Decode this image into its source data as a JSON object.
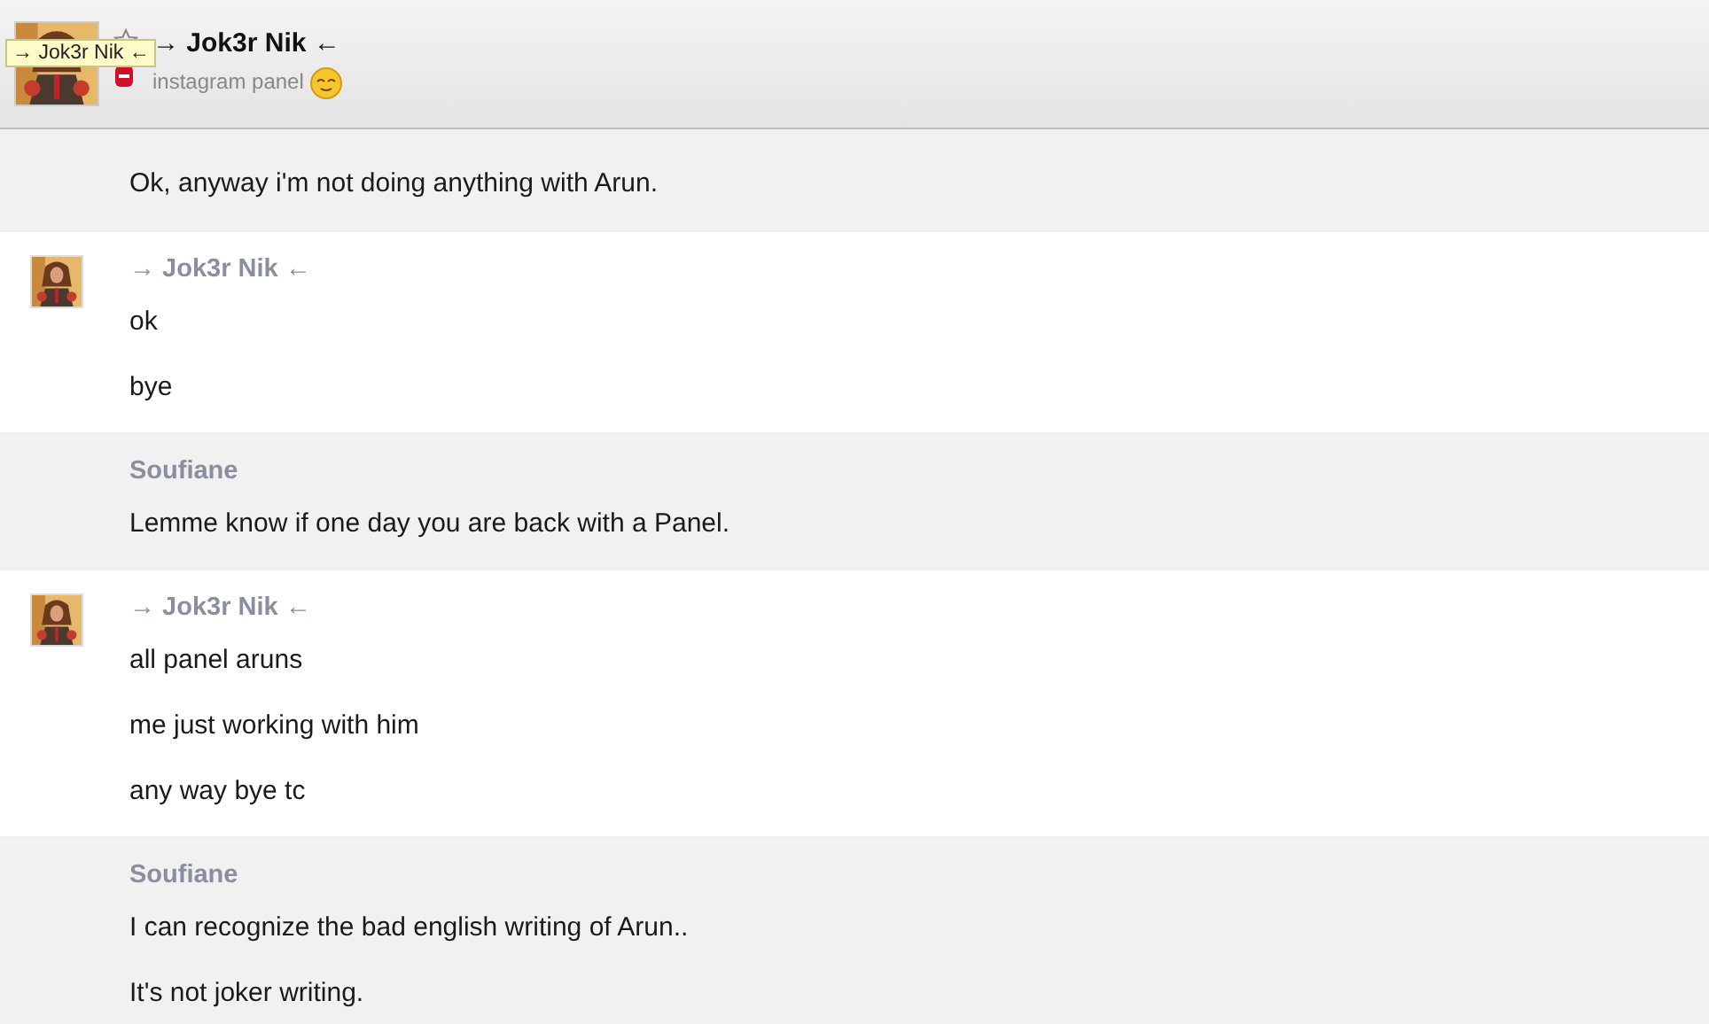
{
  "header": {
    "title": "→ Jok3r Nik ←",
    "subtitle": "instagram panel",
    "tooltip": "→ Jok3r Nik ←",
    "starred": false
  },
  "groups": [
    {
      "avatar": false,
      "shaded": true,
      "messages": [
        "Ok, anyway i'm not doing anything with Arun."
      ]
    },
    {
      "sender": "→ Jok3r Nik ←",
      "avatar": true,
      "shaded": false,
      "messages": [
        "ok",
        "bye"
      ]
    },
    {
      "sender": "Soufiane",
      "avatar": false,
      "shaded": true,
      "messages": [
        "Lemme know if one day you are back with a Panel."
      ]
    },
    {
      "sender": "→ Jok3r Nik ←",
      "avatar": true,
      "shaded": false,
      "messages": [
        "all panel aruns",
        "me just working with him",
        "any way bye tc"
      ]
    },
    {
      "sender": "Soufiane",
      "avatar": false,
      "shaded": true,
      "messages": [
        "I can recognize the bad english writing of Arun..",
        "It's not joker writing."
      ]
    }
  ]
}
